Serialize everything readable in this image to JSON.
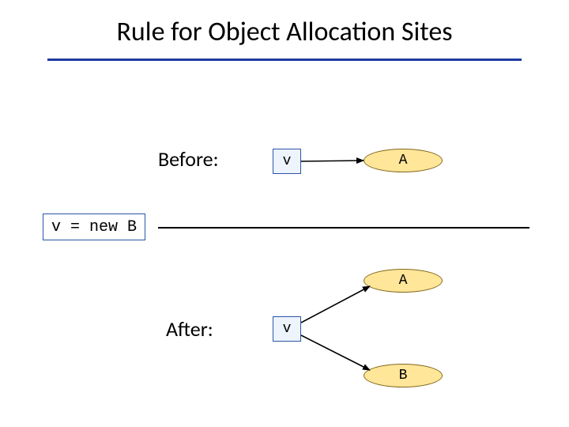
{
  "title": "Rule for Object Allocation Sites",
  "labels": {
    "before": "Before:",
    "after": "After:"
  },
  "code": "v = new B",
  "nodes": {
    "v": "v",
    "A": "A",
    "B": "B"
  },
  "colors": {
    "accent_rule": "#1f3aa3",
    "box_border": "#2a55a8",
    "box_fill": "#eef4fb",
    "ellipse_border": "#83681c",
    "ellipse_fill": "#ffe699"
  }
}
